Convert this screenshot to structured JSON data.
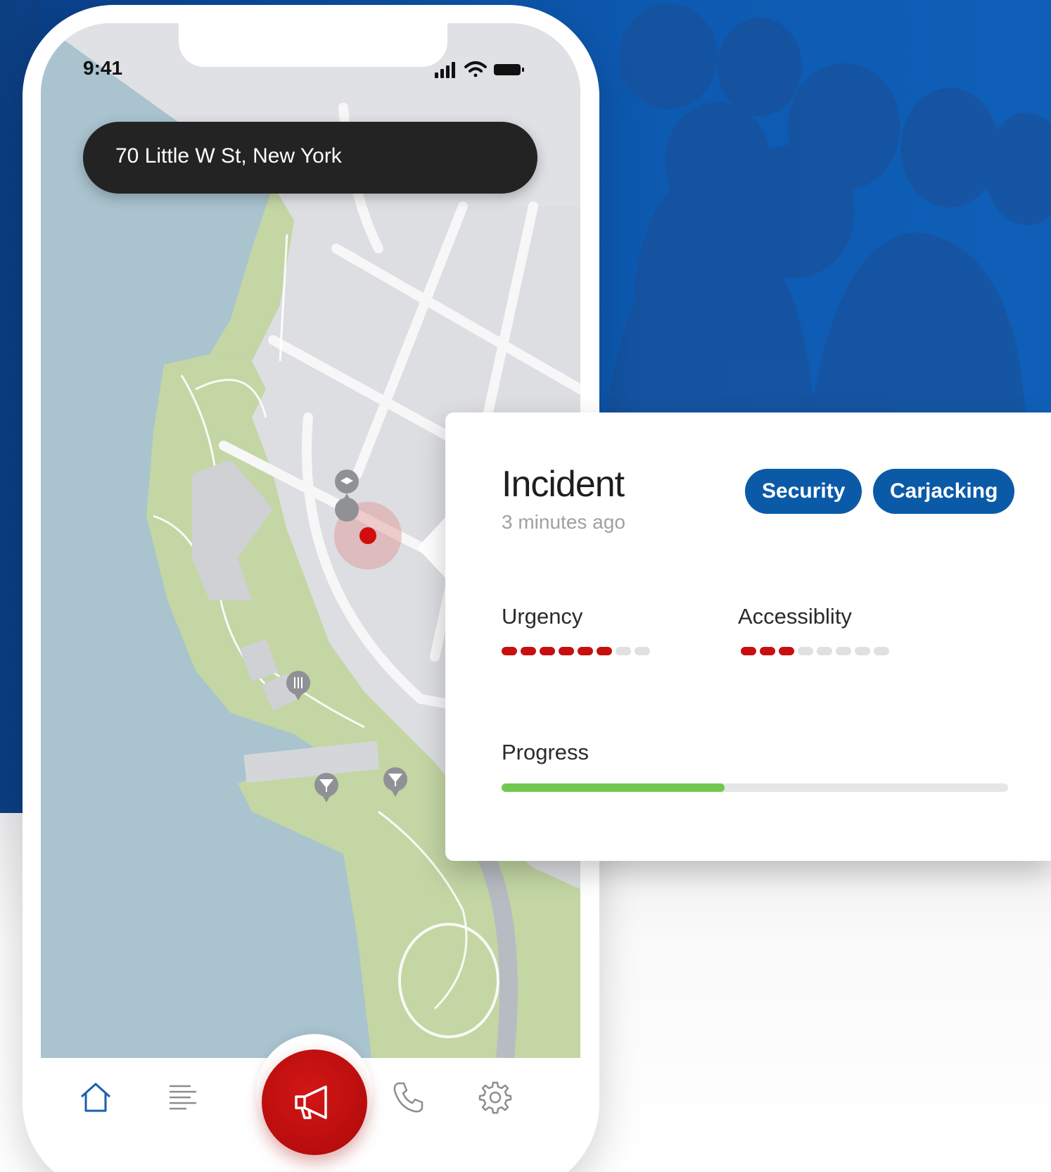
{
  "status_bar": {
    "time": "9:41"
  },
  "address_bar": {
    "address": "70 Little W St, New York"
  },
  "incident": {
    "title": "Incident",
    "time_ago": "3 minutes ago",
    "tags": [
      "Security",
      "Carjacking"
    ],
    "urgency": {
      "label": "Urgency",
      "level": 6,
      "max": 8
    },
    "accessibility": {
      "label": "Accessiblity",
      "level": 3,
      "max": 8
    },
    "progress": {
      "label": "Progress",
      "fraction": 0.44
    }
  },
  "map_markers": [
    "school-marker-icon",
    "restaurant-marker-icon",
    "bar-marker-icon",
    "bar-marker-icon"
  ],
  "bottom_nav": [
    "home-icon",
    "list-icon",
    "megaphone-icon",
    "phone-icon",
    "settings-icon"
  ],
  "colors": {
    "brand_blue": "#0b5aa8",
    "alert_red": "#c70f0f",
    "progress_green": "#71c84e"
  }
}
